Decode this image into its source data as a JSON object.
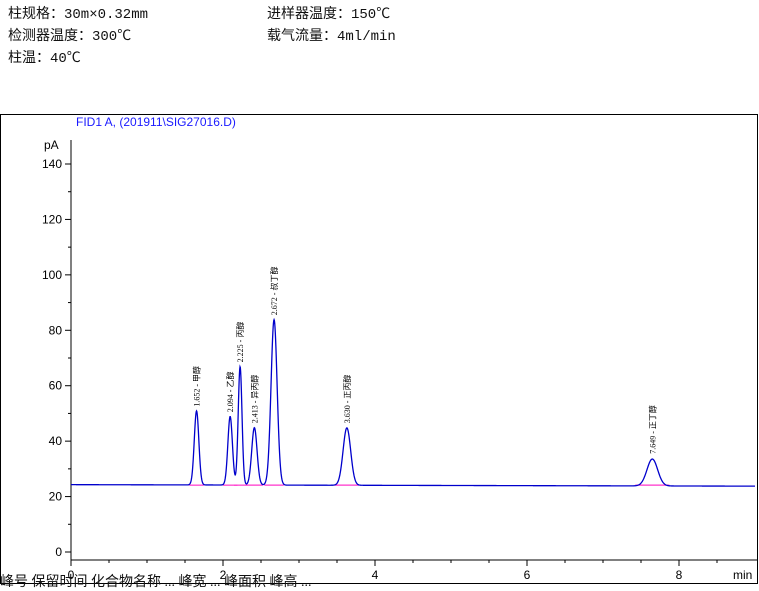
{
  "header": {
    "column_spec": "柱规格：30m×0.32mm",
    "injector_temp": "进样器温度：150℃",
    "detector_temp": "检测器温度：300℃",
    "carrier_flow": "载气流量：4ml/min",
    "column_temp": "柱温：40℃"
  },
  "footer_text": "峰号 保留时间   化合物名称   ... 峰宽 ... 峰面积 峰高 ...",
  "chart_data": {
    "type": "line",
    "title": "FID1 A,  (201911\\SIG27016.D)",
    "xlabel": "min",
    "ylabel": "pA",
    "xlim": [
      0,
      9.0
    ],
    "ylim": [
      -3,
      150
    ],
    "xticks": [
      0,
      2,
      4,
      6,
      8
    ],
    "yticks": [
      0,
      20,
      40,
      60,
      80,
      100,
      120,
      140
    ],
    "grid": false,
    "baseline": 24.3,
    "line_color": "#0000cc",
    "baseline_color": "#ff33cc",
    "peaks": [
      {
        "rt": 1.652,
        "height": 51,
        "width": 0.03,
        "label": "1.652 - 甲醇"
      },
      {
        "rt": 2.094,
        "height": 49,
        "width": 0.03,
        "label": "2.094 - 乙醇"
      },
      {
        "rt": 2.225,
        "height": 67,
        "width": 0.025,
        "label": "2.225 - 丙醇"
      },
      {
        "rt": 2.413,
        "height": 45,
        "width": 0.035,
        "label": "2.413 - 异丙醇"
      },
      {
        "rt": 2.672,
        "height": 84,
        "width": 0.04,
        "label": "2.672 - 叔丁醇"
      },
      {
        "rt": 3.63,
        "height": 45,
        "width": 0.05,
        "label": "3.630 - 正丙醇"
      },
      {
        "rt": 7.649,
        "height": 34,
        "width": 0.07,
        "label": "7.649 - 正丁醇"
      }
    ]
  }
}
